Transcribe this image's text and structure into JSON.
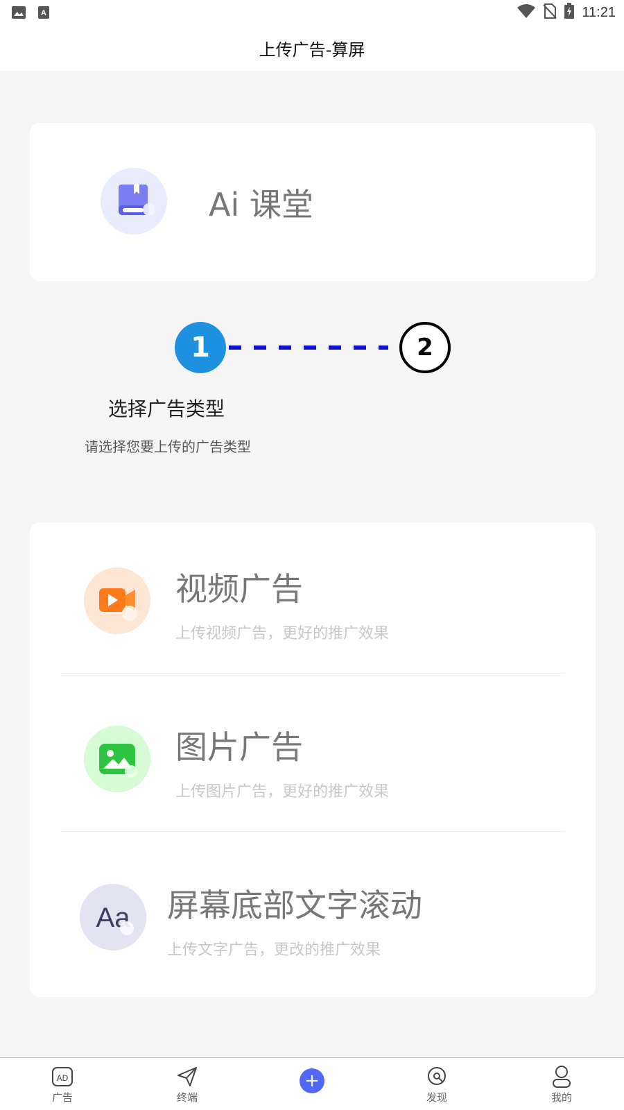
{
  "status_bar": {
    "time": "11:21"
  },
  "nav": {
    "title": "上传广告-算屏"
  },
  "brand": {
    "name": "Ai 课堂"
  },
  "steps": {
    "step1_number": "1",
    "step2_number": "2",
    "current_label": "选择广告类型",
    "hint": "请选择您要上传的广告类型"
  },
  "ad_types": [
    {
      "title": "视频广告",
      "desc": "上传视频广告，更好的推广效果",
      "icon": "video-icon",
      "color": "#ff7a1a"
    },
    {
      "title": "图片广告",
      "desc": "上传图片广告，更好的推广效果",
      "icon": "image-icon",
      "color": "#2ec441"
    },
    {
      "title": "屏幕底部文字滚动",
      "desc": "上传文字广告，更改的推广效果",
      "icon": "text-aa-icon",
      "color": "#3a3f63"
    }
  ],
  "tabs": [
    {
      "label": "广告",
      "icon": "ad-icon"
    },
    {
      "label": "终端",
      "icon": "paper-plane-icon"
    },
    {
      "label": "",
      "icon": "plus-icon"
    },
    {
      "label": "发现",
      "icon": "discover-icon"
    },
    {
      "label": "我的",
      "icon": "user-icon"
    }
  ],
  "colors": {
    "accent": "#1e90e0",
    "step_line": "#1010d8",
    "plus": "#4f68f5"
  }
}
